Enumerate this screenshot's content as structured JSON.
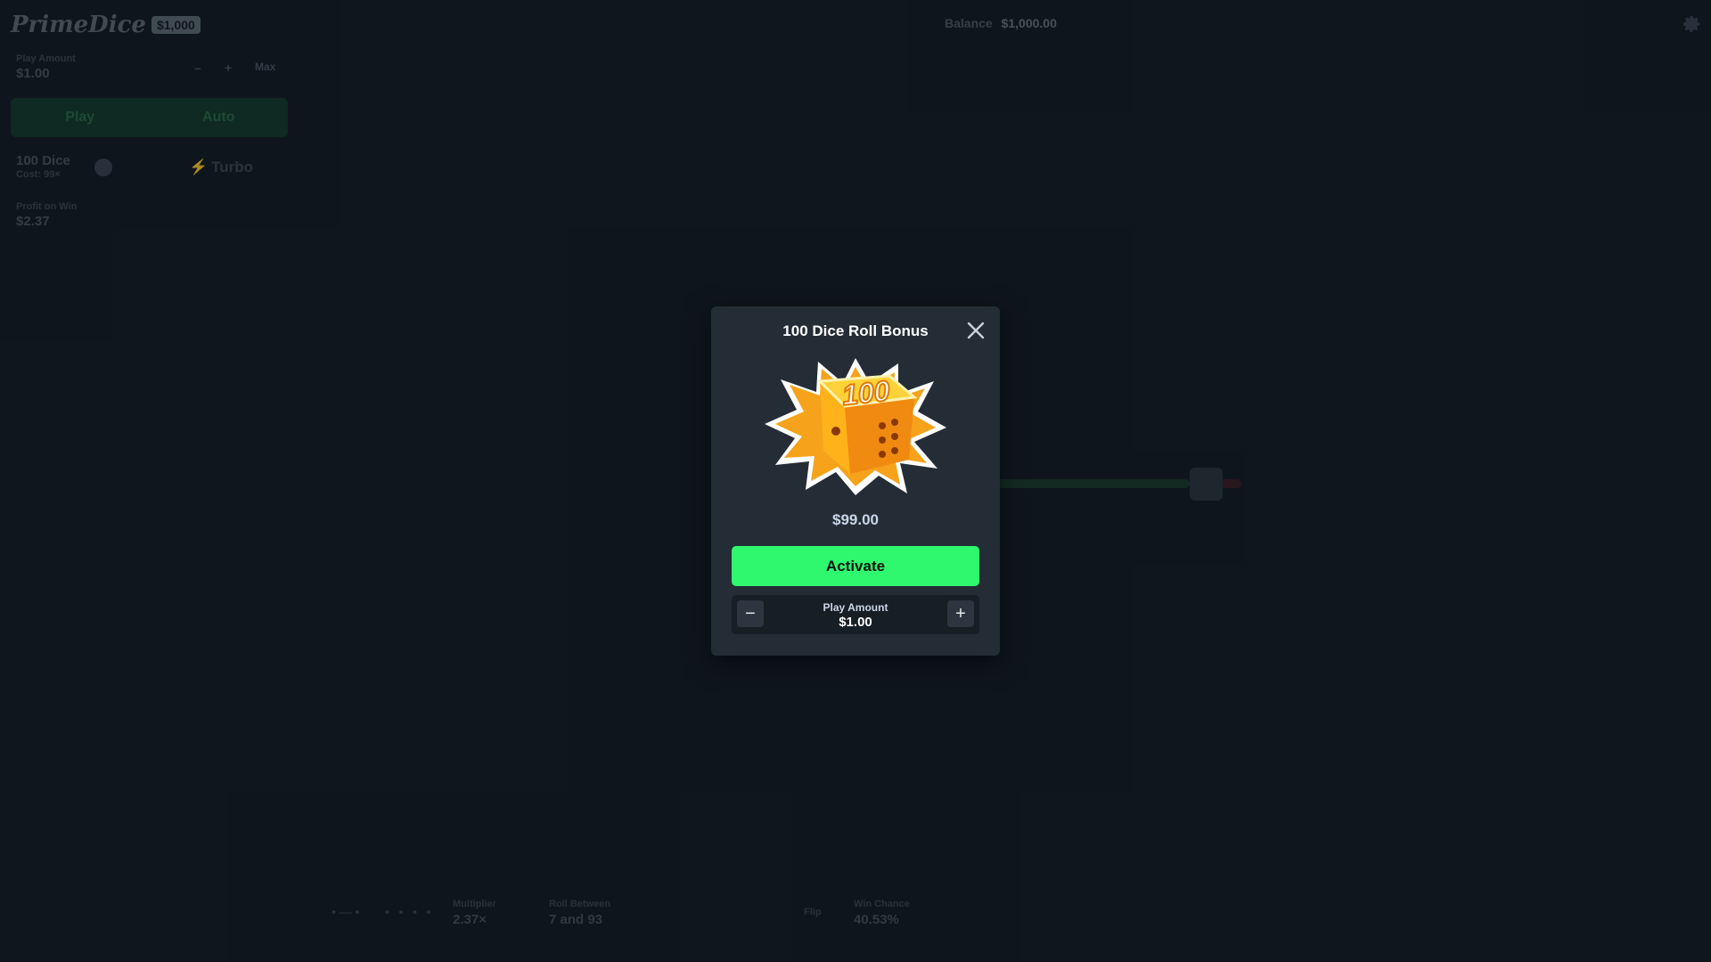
{
  "header": {
    "logo_text": "PrimeDice",
    "logo_badge": "$1,000",
    "balance_label": "Balance",
    "balance_value": "$1,000.00",
    "settings_icon": "gear-icon"
  },
  "side_panel": {
    "play_amount_label": "Play Amount",
    "play_amount_value": "$1.00",
    "minus_label": "–",
    "plus_label": "+",
    "max_label": "Max",
    "play_tab": "Play",
    "auto_tab": "Auto",
    "dice_title": "100 Dice",
    "dice_sub": "Cost: 99×",
    "turbo_label": "Turbo",
    "profit_label": "Profit on Win",
    "profit_value": "$2.37"
  },
  "bottom_stats": {
    "multiplier_label": "Multiplier",
    "multiplier_value": "2.37×",
    "roll_label": "Roll Between",
    "roll_value": "7 and 93",
    "flip_label": "Flip",
    "win_chance_label": "Win Chance",
    "win_chance_value": "40.53%"
  },
  "modal": {
    "title": "100 Dice Roll Bonus",
    "dice_art_text": "100",
    "price": "$99.00",
    "activate_label": "Activate",
    "amount_label": "Play Amount",
    "amount_value": "$1.00",
    "minus_label": "−",
    "plus_label": "+"
  },
  "colors": {
    "accent_green": "#2ff86f",
    "modal_bg": "#242d36",
    "page_bg": "#131a22"
  }
}
